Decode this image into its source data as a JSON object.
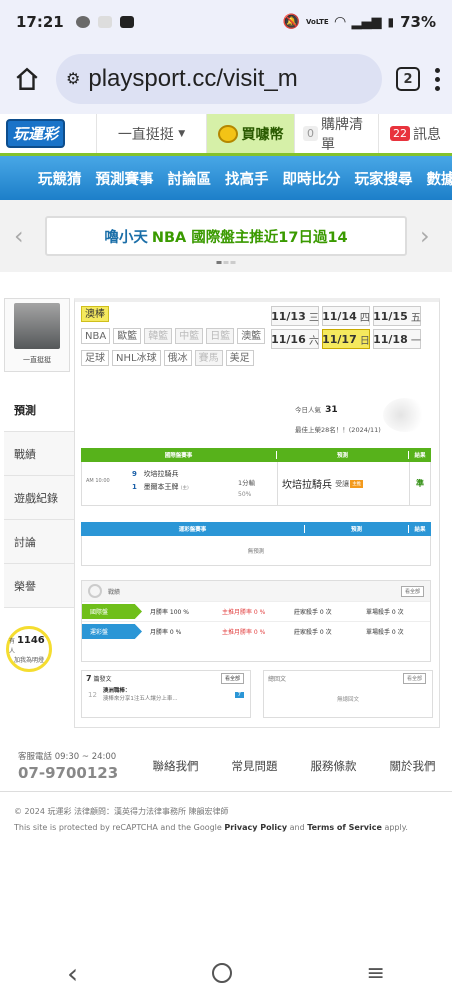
{
  "status": {
    "time": "17:21",
    "battery": "73%",
    "volte": "VoLTE"
  },
  "browser": {
    "url": "playsport.cc/visit_m",
    "tab_count": "2"
  },
  "topnav": {
    "logo": "玩運彩",
    "user": "一直挺挺",
    "coin": "買噱幣",
    "cart_count": "0",
    "cart": "購牌清單",
    "msg_count": "22",
    "msg": "訊息"
  },
  "mainnav": [
    "玩競猜",
    "預測賽事",
    "討論區",
    "找高手",
    "即時比分",
    "玩家搜尋",
    "數據"
  ],
  "marquee": {
    "name": "嚕小天",
    "text": "NBA 國際盤主推近17日過14"
  },
  "profile": {
    "name": "一直挺挺"
  },
  "side_menu": [
    "預測",
    "戰績",
    "遊戲紀錄",
    "討論",
    "榮譽"
  ],
  "fans": {
    "pre": "有",
    "count": "1146",
    "unit": "人",
    "text": "加我為明燈"
  },
  "sports": [
    "澳棒",
    "NBA",
    "歐籃",
    "韓籃",
    "中籃",
    "日籃",
    "澳籃",
    "足球",
    "NHL冰球",
    "俄冰",
    "賽馬",
    "美足"
  ],
  "dates": [
    {
      "d": "11/13",
      "w": "三"
    },
    {
      "d": "11/14",
      "w": "四"
    },
    {
      "d": "11/15",
      "w": "五"
    },
    {
      "d": "11/16",
      "w": "六"
    },
    {
      "d": "11/17",
      "w": "日"
    },
    {
      "d": "11/18",
      "w": "一"
    }
  ],
  "visits": {
    "today_label": "今日人氣",
    "today": "31",
    "rank": "最佳上榮28名！！(2024/11)"
  },
  "intl": {
    "head": [
      "國際盤賽事",
      "預測",
      "結果"
    ],
    "time": "AM 10:00",
    "home_score": "9",
    "home": "坎培拉騎兵",
    "away_score": "1",
    "away": "墨爾本王牌",
    "away_tag": "(主)",
    "line": "1分輸",
    "pct": "50%",
    "pick": "坎培拉騎兵",
    "pick_sub": "受讓",
    "pick_tag": "主推",
    "result": "準"
  },
  "lottery": {
    "head": [
      "運彩盤賽事",
      "預測",
      "結果"
    ],
    "empty": "無預測"
  },
  "record": {
    "title": "戰績",
    "all": "看全部",
    "rows": [
      {
        "label": "國際盤",
        "month": "月勝率 100 %",
        "main": "主推月勝率 0 %",
        "series": "莊家殺手 0 次",
        "killer": "單場殺手 0 次"
      },
      {
        "label": "運彩盤",
        "month": "月勝率 0 %",
        "main": "主推月勝率 0 %",
        "series": "莊家殺手 0 次",
        "killer": "單場殺手 0 次"
      }
    ]
  },
  "articles": {
    "count": "7",
    "title": "篇發文",
    "all": "看全部",
    "day": "12",
    "post_title": "澳洲職棒：",
    "post_text": "澳棒來分享1注五人讓分上車...",
    "reply": "7"
  },
  "replies": {
    "title": "總回文",
    "all": "看全部",
    "empty": "無總回文"
  },
  "footer": {
    "tel_label": "客服電話 09:30 ~ 24:00",
    "tel": "07-9700123",
    "links": [
      "聯絡我們",
      "常見問題",
      "服務條款",
      "關於我們"
    ]
  },
  "copyright": "© 2024 玩運彩 法律顧問：漢英得力法律事務所 陳韻宏律師",
  "recaptcha": {
    "pre": "This site is protected by reCAPTCHA and the Google ",
    "privacy": "Privacy Policy",
    "and": " and ",
    "terms": "Terms of Service",
    "post": " apply."
  }
}
